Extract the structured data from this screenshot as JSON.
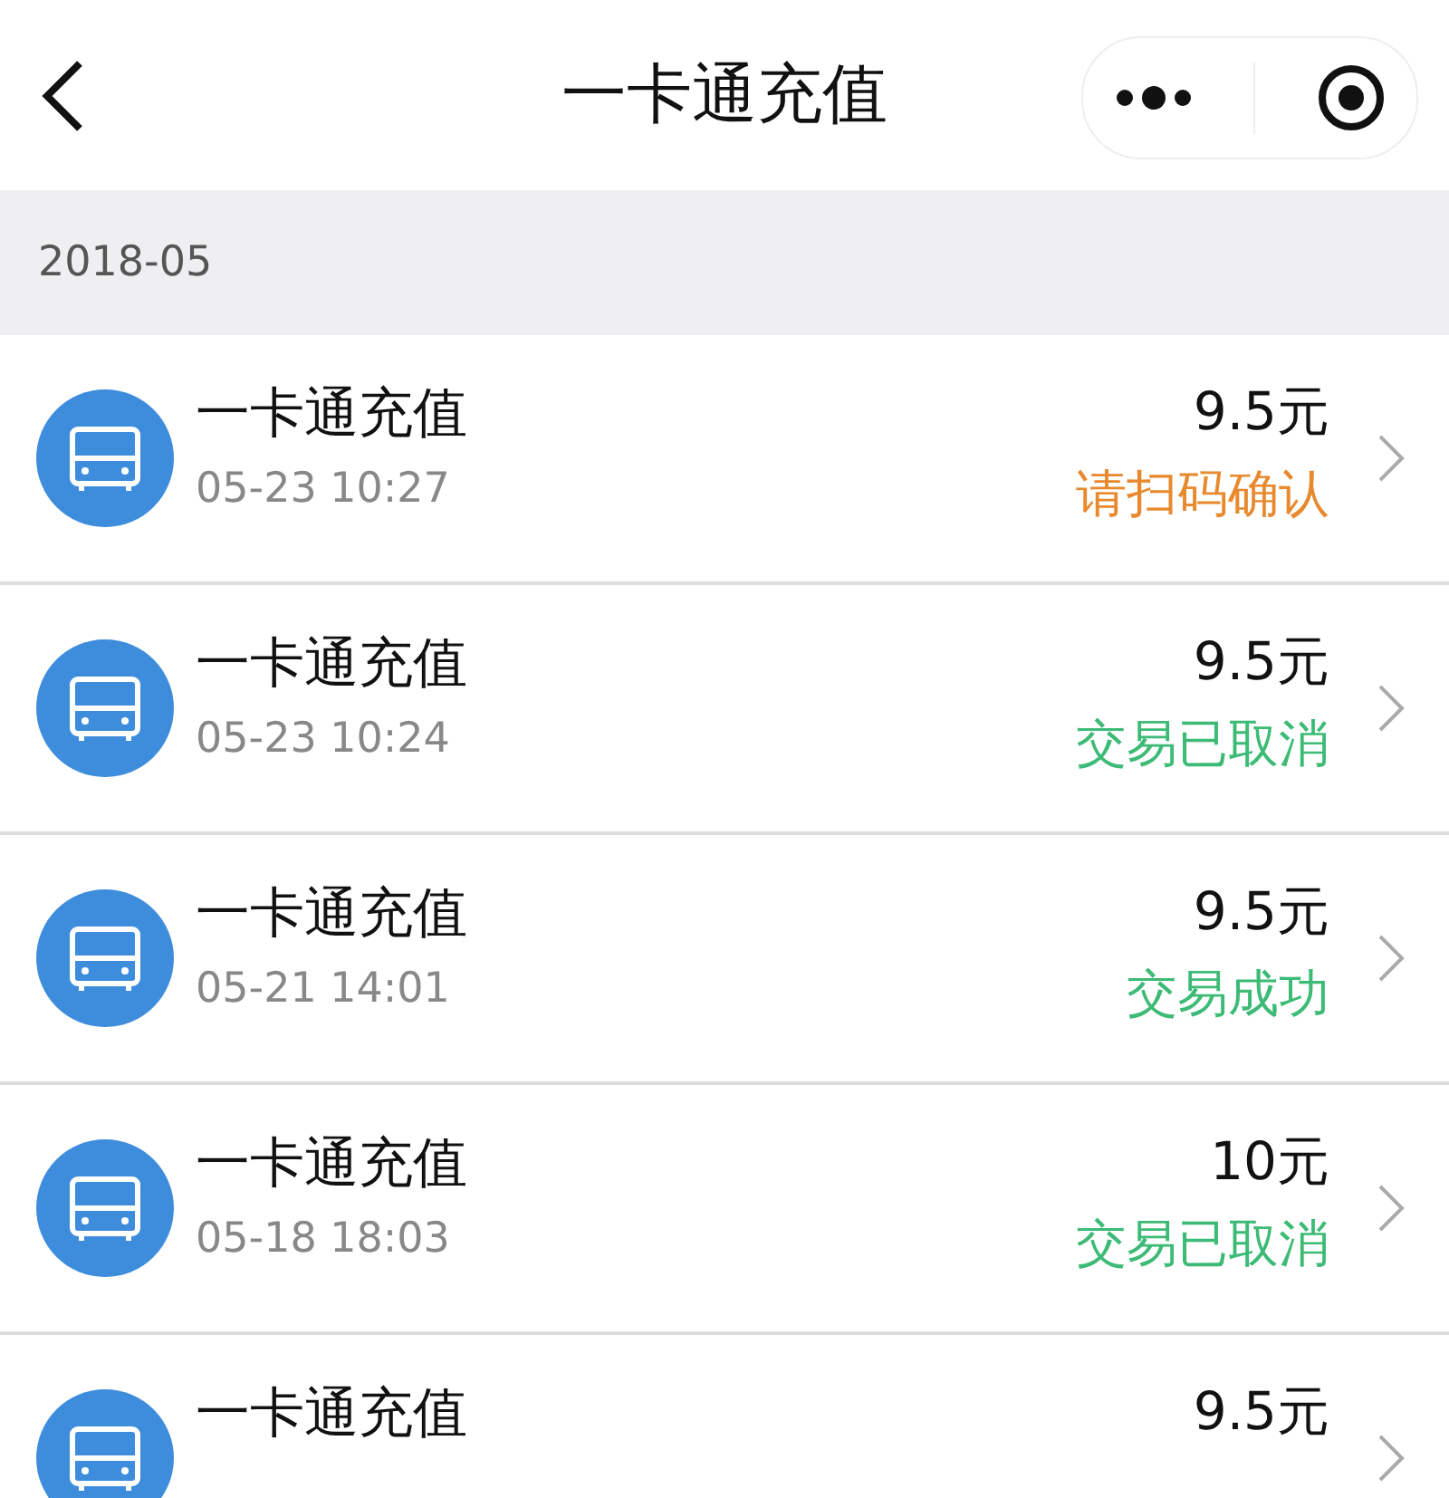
{
  "nav_bar": {
    "title": "一卡通充值"
  },
  "month_header": "2018-05",
  "records": [
    {
      "title": "一卡通充值",
      "time": "05-23 10:27",
      "amount": "9.5元",
      "status": "请扫码确认",
      "color": "#e8892e"
    },
    {
      "title": "一卡通充值",
      "time": "05-23 10:24",
      "amount": "9.5元",
      "status": "交易已取消",
      "color": "#3dbb76"
    },
    {
      "title": "一卡通充值",
      "time": "05-21 14:01",
      "amount": "9.5元",
      "status": "交易成功",
      "color": "#3dbb76"
    },
    {
      "title": "一卡通充值",
      "time": "05-18 18:03",
      "amount": "10元",
      "status": "交易已取消",
      "color": "#3dbb76"
    },
    {
      "title": "一卡通充值",
      "amount": "9.5元"
    }
  ]
}
